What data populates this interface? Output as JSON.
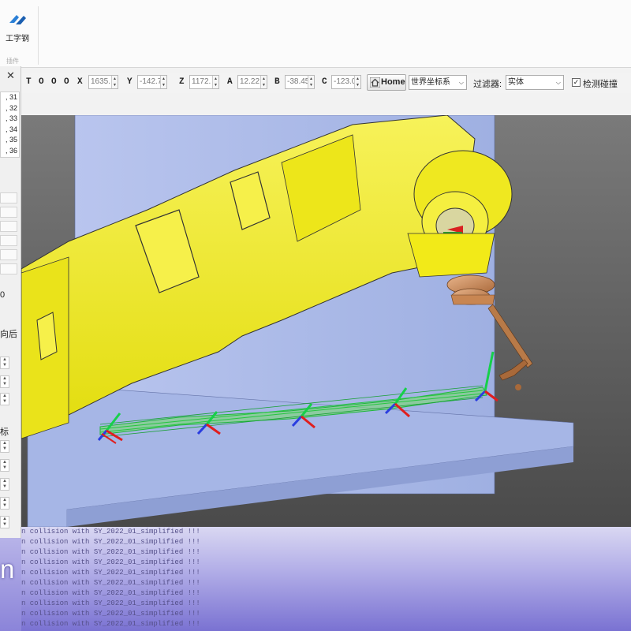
{
  "ribbon": {
    "button_label": "工字钢",
    "group_label": "插件"
  },
  "side_panel": {
    "close_symbol": "✕",
    "list_items": [
      ", 31",
      ", 32",
      ", 33",
      ", 34",
      ", 35",
      ", 36"
    ],
    "text_a": "0",
    "text_b": "向后",
    "text_c": "标"
  },
  "toolbar": {
    "t_label": "T",
    "o_labels": [
      "O",
      "O",
      "O"
    ],
    "x_label": "X",
    "x_value": "1635.",
    "y_label": "Y",
    "y_value": "-142.7",
    "z_label": "Z",
    "z_value": "1172.",
    "a_label": "A",
    "a_value": "12.22",
    "b_label": "B",
    "b_value": "-38.45",
    "c_label": "C",
    "c_value": "-123.0",
    "home_label": "Home",
    "coord_system": "世界坐标系",
    "filter_label": "过滤器:",
    "filter_value": "实体",
    "collision_label": "检测碰撞",
    "collision_checked": true
  },
  "console": {
    "lines": [
      "n collision with SY_2022_01_simplified !!!",
      "n collision with SY_2022_01_simplified !!!",
      "n collision with SY_2022_01_simplified !!!",
      "n collision with SY_2022_01_simplified !!!",
      "n collision with SY_2022_01_simplified !!!",
      "n collision with SY_2022_01_simplified !!!",
      "n collision with SY_2022_01_simplified !!!",
      "n collision with SY_2022_01_simplified !!!",
      "n collision with SY_2022_01_simplified !!!",
      "n collision with SY_2022_01_simplified !!!"
    ],
    "overlay_text": "n"
  },
  "colors": {
    "robot_yellow": "#f2ee1c",
    "wall_blue": "#aab8e6",
    "background_gray": "#6e6e6e",
    "weld_path_green": "#3ee04a",
    "torch_bronze": "#c98a55"
  },
  "icons": {
    "ribbon": "steel-beam-icon",
    "home": "home-icon"
  }
}
